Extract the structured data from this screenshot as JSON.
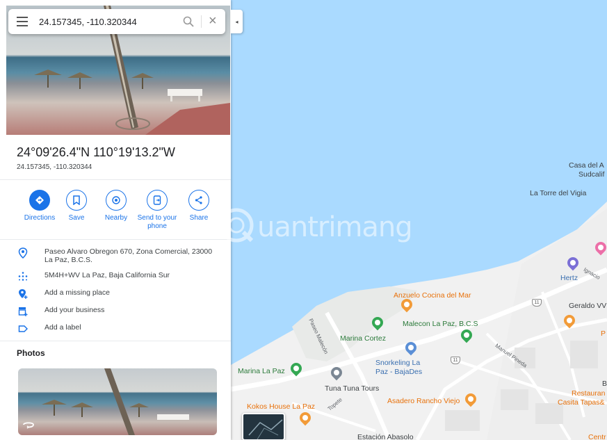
{
  "search": {
    "value": "24.157345, -110.320344"
  },
  "place": {
    "title": "24°09'26.4\"N 110°19'13.2\"W",
    "subtitle": "24.157345, -110.320344"
  },
  "actions": [
    {
      "label": "Directions",
      "icon": "directions-icon"
    },
    {
      "label": "Save",
      "icon": "bookmark-icon"
    },
    {
      "label": "Nearby",
      "icon": "nearby-icon"
    },
    {
      "label": "Send to your phone",
      "icon": "send-to-phone-icon"
    },
    {
      "label": "Share",
      "icon": "share-icon"
    }
  ],
  "info": [
    {
      "text": "Paseo Alvaro Obregon 670, Zona Comercial, 23000 La Paz, B.C.S.",
      "icon": "location-pin-icon"
    },
    {
      "text": "5M4H+WV La Paz, Baja California Sur",
      "icon": "plus-code-icon"
    },
    {
      "text": "Add a missing place",
      "icon": "add-place-icon"
    },
    {
      "text": "Add your business",
      "icon": "add-business-icon"
    },
    {
      "text": "Add a label",
      "icon": "label-icon"
    }
  ],
  "photos": {
    "title": "Photos"
  },
  "map": {
    "labels": {
      "casa": "Casa del A",
      "sudcalif": "Sudcalif",
      "torre": "La Torre del Vigia",
      "hertz": "Hertz",
      "ignacio": "Ignacio",
      "geraldo": "Geraldo VV",
      "p_cut": "P",
      "anzuelo": "Anzuelo Cocina del Mar",
      "malecon": "Malecon La Paz, B.C.S",
      "marina_cortez": "Marina Cortez",
      "paseo": "Paseo Malecón",
      "manuel": "Manuel Pineda",
      "snorkeling_1": "Snorkeling La",
      "snorkeling_2": "Paz - BajaDes",
      "marina_lapaz": "Marina La Paz",
      "tuna": "Tuna Tuna Tours",
      "asadero": "Asadero Rancho Viejo",
      "kokos": "Kokos House La Paz",
      "topete": "Topete",
      "restaurant_1": "Restauran",
      "restaurant_2": "Casita Tapas&",
      "estacion": "Estación Abasolo",
      "b": "B",
      "centr": "Centr",
      "shield_11": "11"
    },
    "colors": {
      "water": "#aadaff",
      "land": "#f1f1f1",
      "pin": "#ea4335",
      "accent": "#1a73e8"
    }
  },
  "watermark": {
    "text": "uantrimang"
  }
}
